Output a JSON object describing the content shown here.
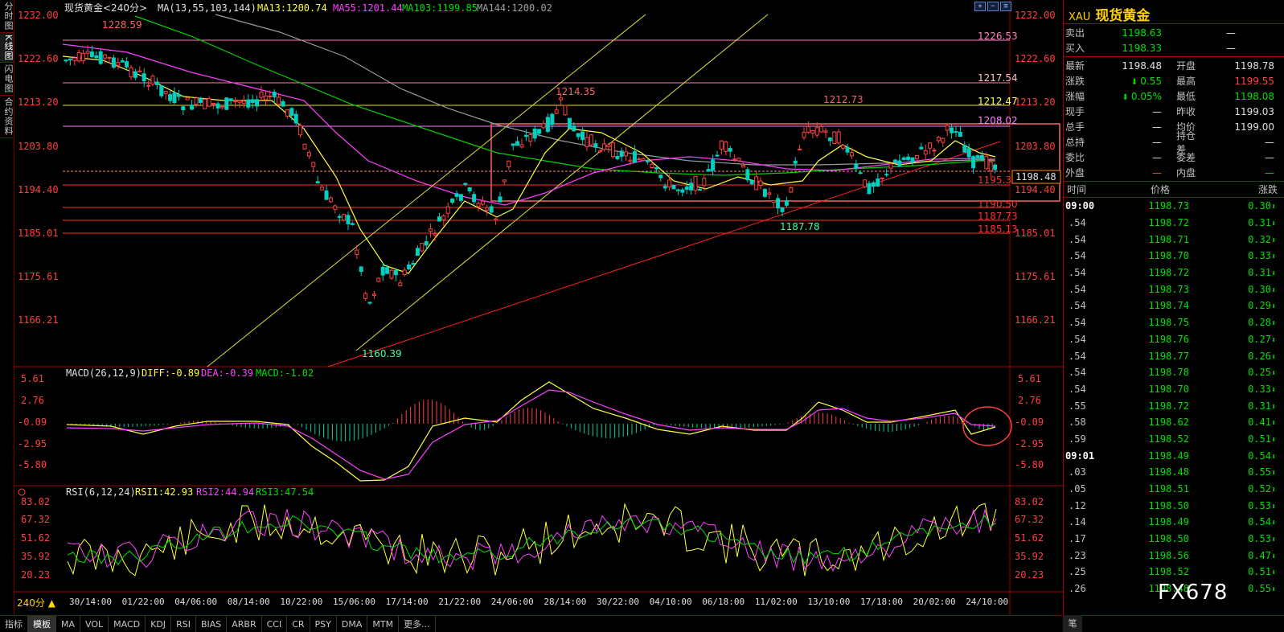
{
  "left_tabs": [
    "分时图",
    "K线图",
    "闪电图",
    "合约资料"
  ],
  "main_legend": {
    "name": "现货黄金<240分>",
    "ma_label": "MA(13,55,103,144)",
    "ma13": "MA13:1200.74",
    "ma55": "MA55:1201.44",
    "ma103": "MA103:1199.85",
    "ma144": "MA144:1200.02"
  },
  "price_axis": [
    "1232.00",
    "1222.60",
    "1213.20",
    "1203.80",
    "1194.40",
    "1185.01",
    "1175.61",
    "1166.21"
  ],
  "level_labels": {
    "high_mark": "1228.59",
    "l1": "1226.53",
    "l2": "1217.54",
    "l3": "1212.47",
    "l4": "1208.02",
    "l5": "1195.38",
    "l6": "1190.50",
    "l7": "1187.73",
    "l8": "1185.13",
    "peak1": "1214.35",
    "peak2": "1212.73",
    "low1": "1187.78",
    "low2": "1160.39",
    "current": "1198.48"
  },
  "macd_legend": {
    "label": "MACD(26,12,9)",
    "diff": "DIFF:-0.89",
    "dea": "DEA:-0.39",
    "macd": "MACD:-1.02"
  },
  "macd_axis": [
    "5.61",
    "2.76",
    "-0.09",
    "-2.95",
    "-5.80"
  ],
  "rsi_legend": {
    "label": "RSI(6,12,24)",
    "rsi1": "RSI1:42.93",
    "rsi2": "RSI2:44.94",
    "rsi3": "RSI3:47.54"
  },
  "rsi_axis": [
    "83.02",
    "67.32",
    "51.62",
    "35.92",
    "20.23"
  ],
  "date_axis": [
    "30/14:00",
    "01/22:00",
    "04/06:00",
    "08/14:00",
    "10/22:00",
    "15/06:00",
    "17/14:00",
    "21/22:00",
    "24/06:00",
    "28/14:00",
    "30/22:00",
    "04/10:00",
    "06/18:00",
    "11/02:00",
    "13/10:00",
    "17/18:00",
    "20/02:00",
    "24/10:00"
  ],
  "timeframe": "240分 ▲",
  "bottom_tabs": [
    "指标",
    "模板",
    "MA",
    "VOL",
    "MACD",
    "KDJ",
    "RSI",
    "BIAS",
    "ARBR",
    "CCI",
    "CR",
    "PSY",
    "DMA",
    "MTM",
    "更多..."
  ],
  "side_corner": "笔",
  "watermark": "FX678",
  "quote": {
    "symbol": "XAU",
    "name": "现货黄金",
    "sell_label": "卖出",
    "sell": "1198.63",
    "sell_vol": "—",
    "buy_label": "买入",
    "buy": "1198.33",
    "buy_vol": "—",
    "rows": [
      {
        "l1": "最新",
        "v1": "1198.48",
        "c1": "wht",
        "l2": "开盘",
        "v2": "1198.78",
        "c2": "wht"
      },
      {
        "l1": "涨跌",
        "v1": "0.55",
        "c1": "green",
        "arrow": true,
        "l2": "最高",
        "v2": "1199.55",
        "c2": "red"
      },
      {
        "l1": "涨幅",
        "v1": "0.05%",
        "c1": "green",
        "arrow": true,
        "l2": "最低",
        "v2": "1198.08",
        "c2": "green"
      },
      {
        "l1": "现手",
        "v1": "—",
        "c1": "wht",
        "l2": "昨收",
        "v2": "1199.03",
        "c2": "wht"
      },
      {
        "l1": "总手",
        "v1": "—",
        "c1": "wht",
        "l2": "均价",
        "v2": "1199.00",
        "c2": "wht"
      },
      {
        "l1": "总持",
        "v1": "—",
        "c1": "wht",
        "l2": "持仓差",
        "v2": "—",
        "c2": "wht"
      },
      {
        "l1": "委比",
        "v1": "—",
        "c1": "wht",
        "l2": "委差",
        "v2": "—",
        "c2": "wht"
      },
      {
        "l1": "外盘",
        "v1": "—",
        "c1": "red",
        "l2": "内盘",
        "v2": "—",
        "c2": "green"
      }
    ],
    "tick_header": [
      "时间",
      "价格",
      "涨跌"
    ],
    "ticks": [
      {
        "t": "09:00",
        "p": "1198.73",
        "c": "0.30"
      },
      {
        "t": ".54",
        "p": "1198.72",
        "c": "0.31"
      },
      {
        "t": ".54",
        "p": "1198.71",
        "c": "0.32"
      },
      {
        "t": ".54",
        "p": "1198.70",
        "c": "0.33"
      },
      {
        "t": ".54",
        "p": "1198.72",
        "c": "0.31"
      },
      {
        "t": ".54",
        "p": "1198.73",
        "c": "0.30"
      },
      {
        "t": ".54",
        "p": "1198.74",
        "c": "0.29"
      },
      {
        "t": ".54",
        "p": "1198.75",
        "c": "0.28"
      },
      {
        "t": ".54",
        "p": "1198.76",
        "c": "0.27"
      },
      {
        "t": ".54",
        "p": "1198.77",
        "c": "0.26"
      },
      {
        "t": ".54",
        "p": "1198.78",
        "c": "0.25"
      },
      {
        "t": ".54",
        "p": "1198.70",
        "c": "0.33"
      },
      {
        "t": ".55",
        "p": "1198.72",
        "c": "0.31"
      },
      {
        "t": ".58",
        "p": "1198.62",
        "c": "0.41"
      },
      {
        "t": ".59",
        "p": "1198.52",
        "c": "0.51"
      },
      {
        "t": "09:01",
        "p": "1198.49",
        "c": "0.54"
      },
      {
        "t": ".03",
        "p": "1198.48",
        "c": "0.55"
      },
      {
        "t": ".05",
        "p": "1198.51",
        "c": "0.52"
      },
      {
        "t": ".12",
        "p": "1198.50",
        "c": "0.53"
      },
      {
        "t": ".14",
        "p": "1198.49",
        "c": "0.54"
      },
      {
        "t": ".17",
        "p": "1198.50",
        "c": "0.53"
      },
      {
        "t": ".23",
        "p": "1198.56",
        "c": "0.47"
      },
      {
        "t": ".25",
        "p": "1198.52",
        "c": "0.51"
      },
      {
        "t": ".26",
        "p": "1198.48",
        "c": "0.55"
      }
    ]
  },
  "colors": {
    "up": "#ff4040",
    "down": "#00c8c8",
    "ma13": "#ffff40",
    "ma55": "#ff40ff",
    "ma103": "#00e000",
    "ma144": "#a0a0a0",
    "level_pink": "#ff80c0",
    "level_yellow": "#e0e040",
    "level_red": "#ff3030",
    "channel": "#e0e040",
    "trend": "#ff2020"
  }
}
